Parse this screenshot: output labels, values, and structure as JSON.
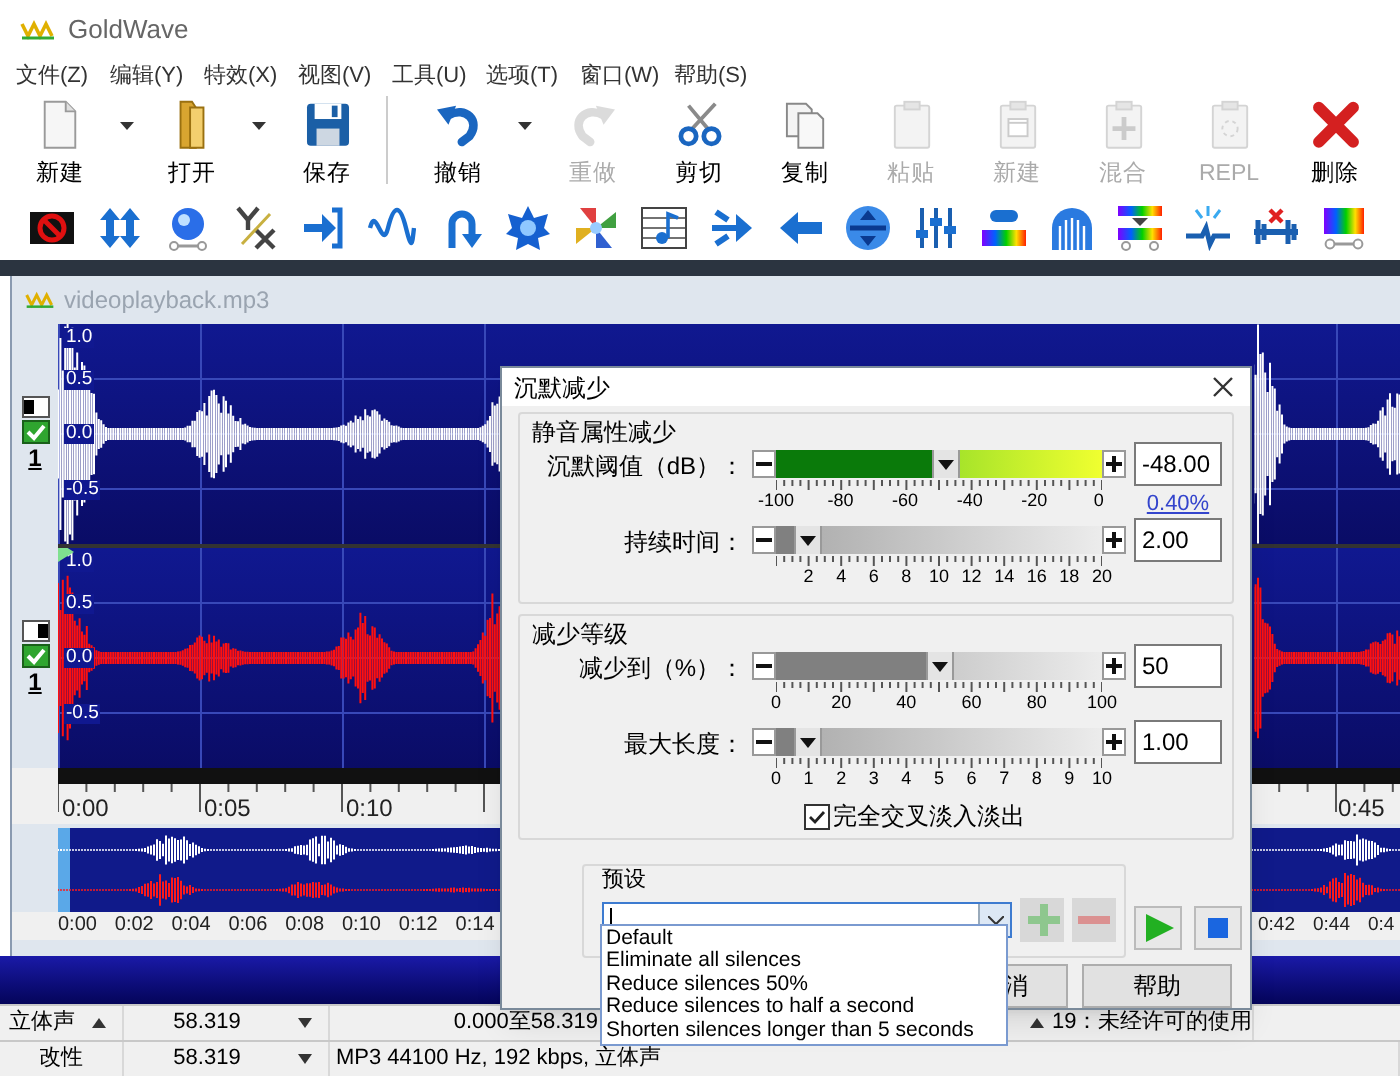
{
  "app": {
    "title": "GoldWave"
  },
  "menu": [
    "文件(Z)",
    "编辑(Y)",
    "特效(X)",
    "视图(V)",
    "工具(U)",
    "选项(T)",
    "窗口(W)",
    "帮助(S)"
  ],
  "toolbar": [
    [
      {
        "label": "新建",
        "disabled": false,
        "dropdown": true
      },
      {
        "label": "打开",
        "disabled": false,
        "dropdown": true
      },
      {
        "label": "保存",
        "disabled": false,
        "dropdown": false
      }
    ],
    [
      {
        "label": "撤销",
        "disabled": false,
        "dropdown": true
      },
      {
        "label": "重做",
        "disabled": true,
        "dropdown": false
      },
      {
        "label": "剪切",
        "disabled": false,
        "dropdown": false
      },
      {
        "label": "复制",
        "disabled": false,
        "dropdown": false
      },
      {
        "label": "粘贴",
        "disabled": true,
        "dropdown": false
      },
      {
        "label": "新建",
        "disabled": true,
        "dropdown": false
      },
      {
        "label": "混合",
        "disabled": true,
        "dropdown": false
      },
      {
        "label": "REPL",
        "disabled": true,
        "dropdown": false
      },
      {
        "label": "删除",
        "disabled": false,
        "dropdown": false
      }
    ]
  ],
  "document": {
    "title": "videoplayback.mp3",
    "channels": [
      {
        "number": "1",
        "enabled": true,
        "kind": "left",
        "color": "#ffffff",
        "axis": [
          "1.0",
          "0.5",
          "0.0",
          "-0.5"
        ]
      },
      {
        "number": "1",
        "enabled": true,
        "kind": "right",
        "color": "#ff1010",
        "axis": [
          "1.0",
          "0.5",
          "0.0",
          "-0.5"
        ]
      }
    ],
    "timeline": {
      "start": [
        "0:00",
        "0:05",
        "0:10"
      ],
      "end": [
        "0:45"
      ]
    },
    "overview": {
      "start": [
        "0:00",
        "0:02",
        "0:04",
        "0:06",
        "0:08",
        "0:10",
        "0:12",
        "0:14"
      ],
      "end": [
        "0:42",
        "0:44",
        "0:4"
      ]
    }
  },
  "status_bar": [
    [
      {
        "text": "立体声",
        "kind": "up"
      },
      {
        "text": "58.319",
        "kind": "down"
      },
      {
        "text": "0.000至58.319",
        "kind": "plain"
      },
      {
        "text": "19：未经许可的使用",
        "kind": "up"
      }
    ],
    [
      {
        "text": "改性",
        "kind": "plain"
      },
      {
        "text": "58.319",
        "kind": "down"
      },
      {
        "text": "MP3 44100 Hz, 192 kbps, 立体声",
        "kind": "plain"
      }
    ]
  ],
  "dialog": {
    "title": "沉默减少",
    "groups": [
      {
        "title": "静音属性减少",
        "rows": [
          {
            "label": "沉默阈值（dB）：",
            "kind": "green",
            "level": 0.52,
            "ticks": [
              "-100",
              "-80",
              "-60",
              "-40",
              "-20",
              "0"
            ],
            "value": "-48.00",
            "note": "0.40%"
          },
          {
            "label": "持续时间：",
            "kind": "gray",
            "level": 0.1,
            "ticks": [
              "2",
              "4",
              "6",
              "8",
              "10",
              "12",
              "14",
              "16",
              "18",
              "20"
            ],
            "value": "2.00"
          }
        ]
      },
      {
        "title": "减少等级",
        "rows": [
          {
            "label": "减少到（%）：",
            "kind": "gray",
            "level": 0.5,
            "ticks": [
              "0",
              "20",
              "40",
              "60",
              "80",
              "100"
            ],
            "value": "50"
          },
          {
            "label": "最大长度：",
            "kind": "gray",
            "level": 0.1,
            "ticks": [
              "0",
              "1",
              "2",
              "3",
              "4",
              "5",
              "6",
              "7",
              "8",
              "9",
              "10"
            ],
            "value": "1.00"
          }
        ],
        "checkbox": {
          "label": "完全交叉淡入淡出",
          "checked": true
        }
      }
    ],
    "preset": {
      "title": "预设",
      "expanded": true,
      "options": [
        "Default",
        "Eliminate all silences",
        "Reduce silences 50%",
        "Reduce silences to half a second",
        "Shorten silences longer than 5 seconds"
      ],
      "buttons": [
        {
          "kind": "add",
          "disabled": true
        },
        {
          "kind": "remove",
          "disabled": true
        },
        {
          "kind": "play",
          "disabled": false
        },
        {
          "kind": "stop",
          "disabled": false
        }
      ]
    },
    "buttons": [
      {
        "label": "消"
      },
      {
        "label": "帮助"
      }
    ]
  }
}
